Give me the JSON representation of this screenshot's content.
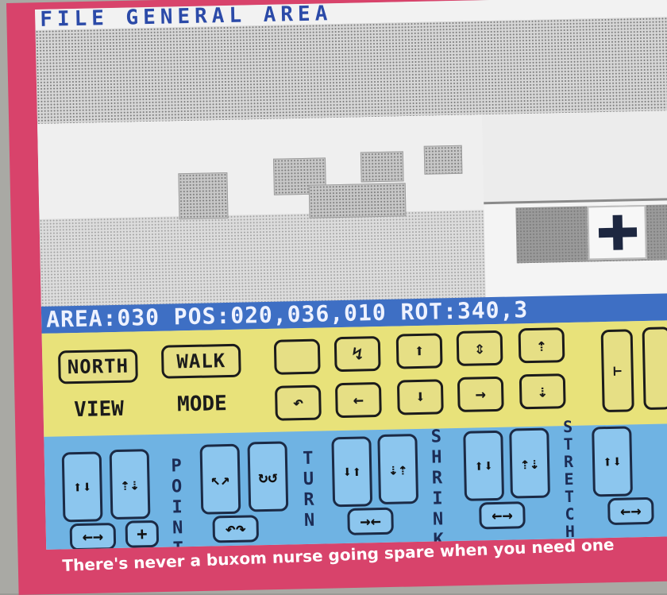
{
  "screen": {
    "title_bar": "FILE  GENERAL  AREA",
    "status": "AREA:030 POS:020,036,010 ROT:340,3"
  },
  "control_panel": {
    "yellow": {
      "north": "NORTH",
      "walk": "WALK",
      "view": "VIEW",
      "mode": "MODE",
      "top_row": [
        "",
        "↯",
        "⬆",
        "⇕",
        "⇡"
      ],
      "bottom_row": [
        "↶",
        "←",
        "⬇",
        "→",
        "⇣"
      ],
      "edge": "⊢"
    },
    "blue": {
      "groups": [
        {
          "label": "POINT",
          "buttons": [
            "⬆⬇",
            "⇡⇣",
            "←→",
            "+"
          ]
        },
        {
          "label": "TURN",
          "buttons": [
            "↖↗",
            "↻↺",
            "↶↷"
          ]
        },
        {
          "label": "SHRINK",
          "buttons": [
            "⬇⬆",
            "⇣⇡",
            "→←"
          ]
        },
        {
          "label": "STRETCH",
          "buttons": [
            "⬆⬇",
            "⇡⇣",
            "←→"
          ]
        }
      ],
      "edge_buttons": [
        "⬆⬇",
        "←→"
      ]
    }
  },
  "caption": "There's never a buxom nurse going spare when you need one",
  "colors": {
    "frame": "#d8436b",
    "status_bar": "#3e6fc4",
    "yellow_panel": "#e8e27a",
    "blue_panel": "#6fb3e3"
  }
}
